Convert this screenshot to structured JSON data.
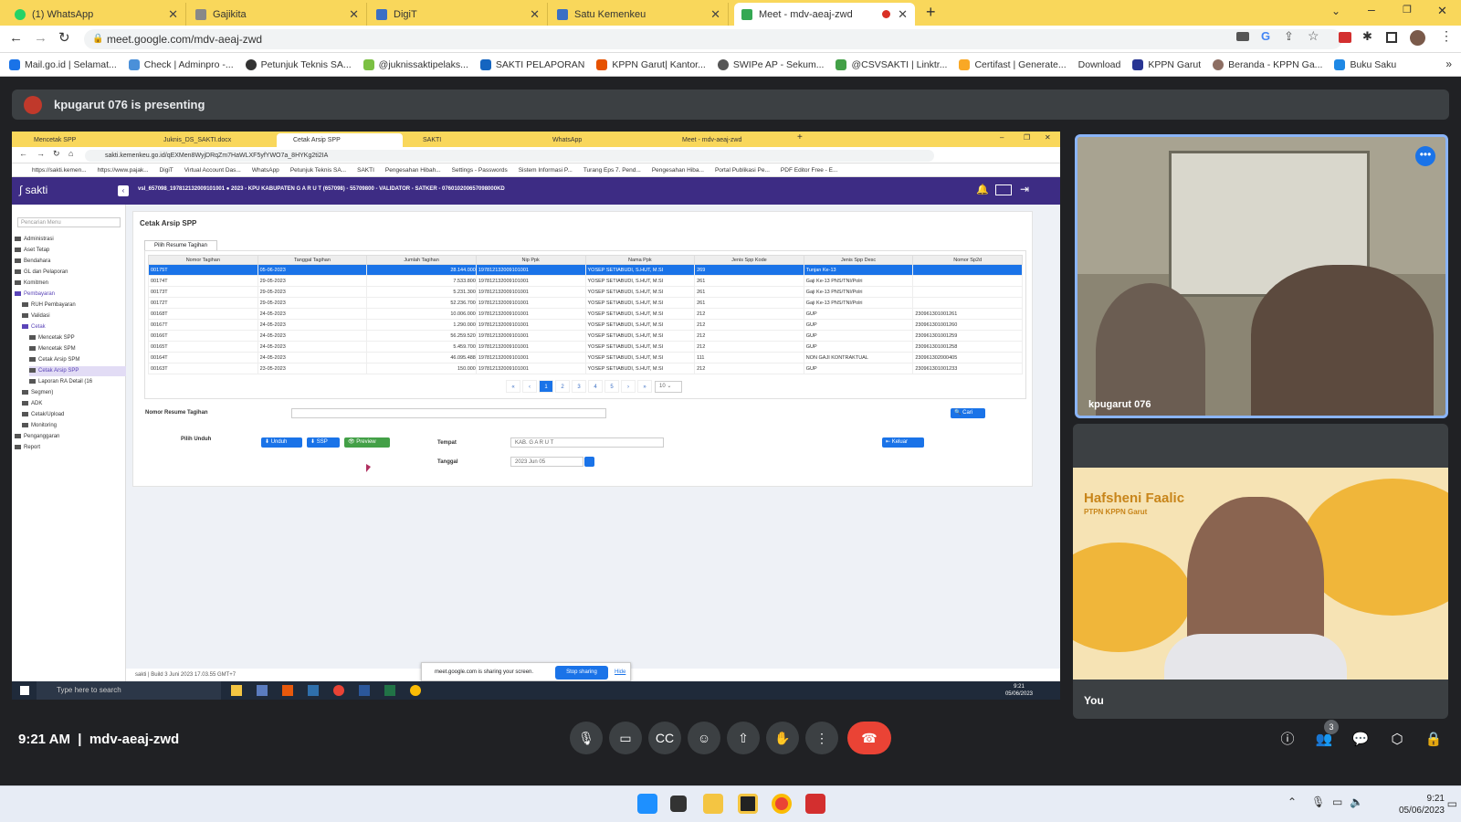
{
  "browser": {
    "tabs": [
      {
        "label": "(1) WhatsApp",
        "color": "#25d366"
      },
      {
        "label": "Gajikita",
        "color": "#888"
      },
      {
        "label": "DigiT",
        "color": "#3b6fc4"
      },
      {
        "label": "Satu Kemenkeu",
        "color": "#3b6fc4"
      },
      {
        "label": "Meet - mdv-aeaj-zwd",
        "color": "#34a853"
      }
    ],
    "url": "meet.google.com/mdv-aeaj-zwd",
    "bookmarks": [
      "Mail.go.id | Selamat...",
      "Check | Adminpro -...",
      "Petunjuk Teknis SA...",
      "@juknissaktipelaks...",
      "SAKTI PELAPORAN",
      "KPPN Garut| Kantor...",
      "SWIPe AP - Sekum...",
      "@CSVSAKTI | Linktr...",
      "Certifast | Generate...",
      "Download",
      "KPPN Garut",
      "Beranda - KPPN Ga...",
      "Buku Saku"
    ]
  },
  "meet": {
    "presenting": "kpugarut 076 is presenting",
    "time": "9:21 AM",
    "meeting_code": "mdv-aeaj-zwd",
    "participants_badge": "3",
    "tiles": [
      {
        "name": "kpugarut 076"
      },
      {
        "name": "You",
        "banner_name": "Hafsheni Faalic",
        "banner_sub": "PTPN KPPN Garut"
      }
    ],
    "controls": [
      "mic-icon",
      "camera-icon",
      "captions-icon",
      "emoji-icon",
      "present-icon",
      "raise-hand-icon",
      "more-icon",
      "hangup-icon"
    ]
  },
  "shared": {
    "tabs": [
      "Mencetak SPP",
      "Juknis_DS_SAKTI.docx",
      "Cetak Arsip SPP",
      "SAKTI",
      "WhatsApp",
      "Meet - mdv-aeaj-zwd"
    ],
    "url": "sakti.kemenkeu.go.id/qEXMen8WyjDRqZm7HaWLXF5yfYWO7a_8HYKg2ti2IA",
    "bookmarks": [
      "https://sakti.kemen...",
      "https://www.pajak...",
      "DigiT",
      "Virtual Account Das...",
      "WhatsApp",
      "Petunjuk Teknis SA...",
      "SAKTI",
      "Pengesahan Hibah...",
      "Settings - Passwords",
      "Sistem Informasi P...",
      "Turang Eps 7. Pend...",
      "Pengesahan Hiba...",
      "Portal Publikasi Pe...",
      "PDF Editor Free - E..."
    ],
    "app_name": "sakti",
    "header_info": "vsl_657098_197812132009101001 ● 2023 - KPU KABUPATEN G A R U T (657098) - 55709800 - VALIDATOR - SATKER - 076010200657098000KD",
    "search_placeholder": "Pencarian Menu",
    "menu": [
      {
        "label": "Administrasi",
        "indent": 0
      },
      {
        "label": "Aset Tetap",
        "indent": 0
      },
      {
        "label": "Bendahara",
        "indent": 0
      },
      {
        "label": "GL dan Pelaporan",
        "indent": 0
      },
      {
        "label": "Komitmen",
        "indent": 0
      },
      {
        "label": "Pembayaran",
        "indent": 0,
        "active": true
      },
      {
        "label": "RUH Pembayaran",
        "indent": 1
      },
      {
        "label": "Validasi",
        "indent": 1
      },
      {
        "label": "Cetak",
        "indent": 1,
        "active": true
      },
      {
        "label": "Mencetak SPP",
        "indent": 2
      },
      {
        "label": "Mencetak SPM",
        "indent": 2
      },
      {
        "label": "Cetak Arsip SPM",
        "indent": 2
      },
      {
        "label": "Cetak Arsip SPP",
        "indent": 2,
        "selected": true
      },
      {
        "label": "Laporan RA Detail (16",
        "indent": 2
      },
      {
        "label": "Segmen)",
        "indent": 1
      },
      {
        "label": "ADK",
        "indent": 1
      },
      {
        "label": "Cetak/Upload",
        "indent": 1
      },
      {
        "label": "Monitoring",
        "indent": 1
      },
      {
        "label": "Penganggaran",
        "indent": 0
      },
      {
        "label": "Report",
        "indent": 0
      }
    ],
    "page_title": "Cetak Arsip SPP",
    "subtab": "Pilih Resume Tagihan",
    "columns": [
      "Nomor Tagihan",
      "Tanggal Tagihan",
      "Jumlah Tagihan",
      "Nip Ppk",
      "Nama Ppk",
      "Jenis Spp Kode",
      "Jenis Spp Desc",
      "Nomor Sp2d"
    ],
    "rows": [
      [
        "00175T",
        "05-06-2023",
        "28.144.000",
        "197812132009101001",
        "YOSEP SETIABUDI, S.HUT, M.SI",
        "269",
        "Tunjan Ke-13",
        ""
      ],
      [
        "00174T",
        "29-05-2023",
        "7.533.800",
        "197812132009101001",
        "YOSEP SETIABUDI, S.HUT, M.SI",
        "261",
        "Gaji Ke-13 PNS/TNI/Polri",
        ""
      ],
      [
        "00173T",
        "29-05-2023",
        "5.231.300",
        "197812132009101001",
        "YOSEP SETIABUDI, S.HUT, M.SI",
        "261",
        "Gaji Ke-13 PNS/TNI/Polri",
        ""
      ],
      [
        "00172T",
        "29-05-2023",
        "52.236.700",
        "197812132009101001",
        "YOSEP SETIABUDI, S.HUT, M.SI",
        "261",
        "Gaji Ke-13 PNS/TNI/Polri",
        ""
      ],
      [
        "00168T",
        "24-05-2023",
        "10.006.000",
        "197812132009101001",
        "YOSEP SETIABUDI, S.HUT, M.SI",
        "212",
        "GUP",
        "230961301001261"
      ],
      [
        "00167T",
        "24-05-2023",
        "1.290.000",
        "197812132009101001",
        "YOSEP SETIABUDI, S.HUT, M.SI",
        "212",
        "GUP",
        "230961301001260"
      ],
      [
        "00166T",
        "24-05-2023",
        "56.259.520",
        "197812132009101001",
        "YOSEP SETIABUDI, S.HUT, M.SI",
        "212",
        "GUP",
        "230961301001259"
      ],
      [
        "00165T",
        "24-05-2023",
        "5.459.700",
        "197812132009101001",
        "YOSEP SETIABUDI, S.HUT, M.SI",
        "212",
        "GUP",
        "230961301001258"
      ],
      [
        "00164T",
        "24-05-2023",
        "46.095.488",
        "197812132009101001",
        "YOSEP SETIABUDI, S.HUT, M.SI",
        "111",
        "NON GAJI KONTRAKTUAL",
        "230961302000405"
      ],
      [
        "00163T",
        "23-05-2023",
        "150.000",
        "197812132009101001",
        "YOSEP SETIABUDI, S.HUT, M.SI",
        "212",
        "GUP",
        "230961301001233"
      ]
    ],
    "pages": [
      "«",
      "‹",
      "1",
      "2",
      "3",
      "4",
      "5",
      "›",
      "»"
    ],
    "page_size": "10",
    "resume_label": "Nomor Resume Tagihan",
    "cari": "Cari",
    "pilih_unduh": "Pilih Unduh",
    "btn_unduh": "Unduh",
    "btn_ssp": "SSP",
    "btn_preview": "Preview",
    "tempat_label": "Tempat",
    "tempat_value": "KAB. G A R U T",
    "tanggal_label": "Tanggal",
    "tanggal_value": "2023 Jun 05",
    "keluar": "Keluar",
    "build": "Build 3 Juni 2023 17.03.55 GMT+7",
    "share_note": "meet.google.com is sharing your screen.",
    "stop_sharing": "Stop sharing",
    "hide": "Hide",
    "taskbar_search": "Type here to search",
    "taskbar_time": "9:21",
    "taskbar_date": "05/06/2023"
  },
  "windows": {
    "time": "9:21",
    "date": "05/06/2023"
  }
}
